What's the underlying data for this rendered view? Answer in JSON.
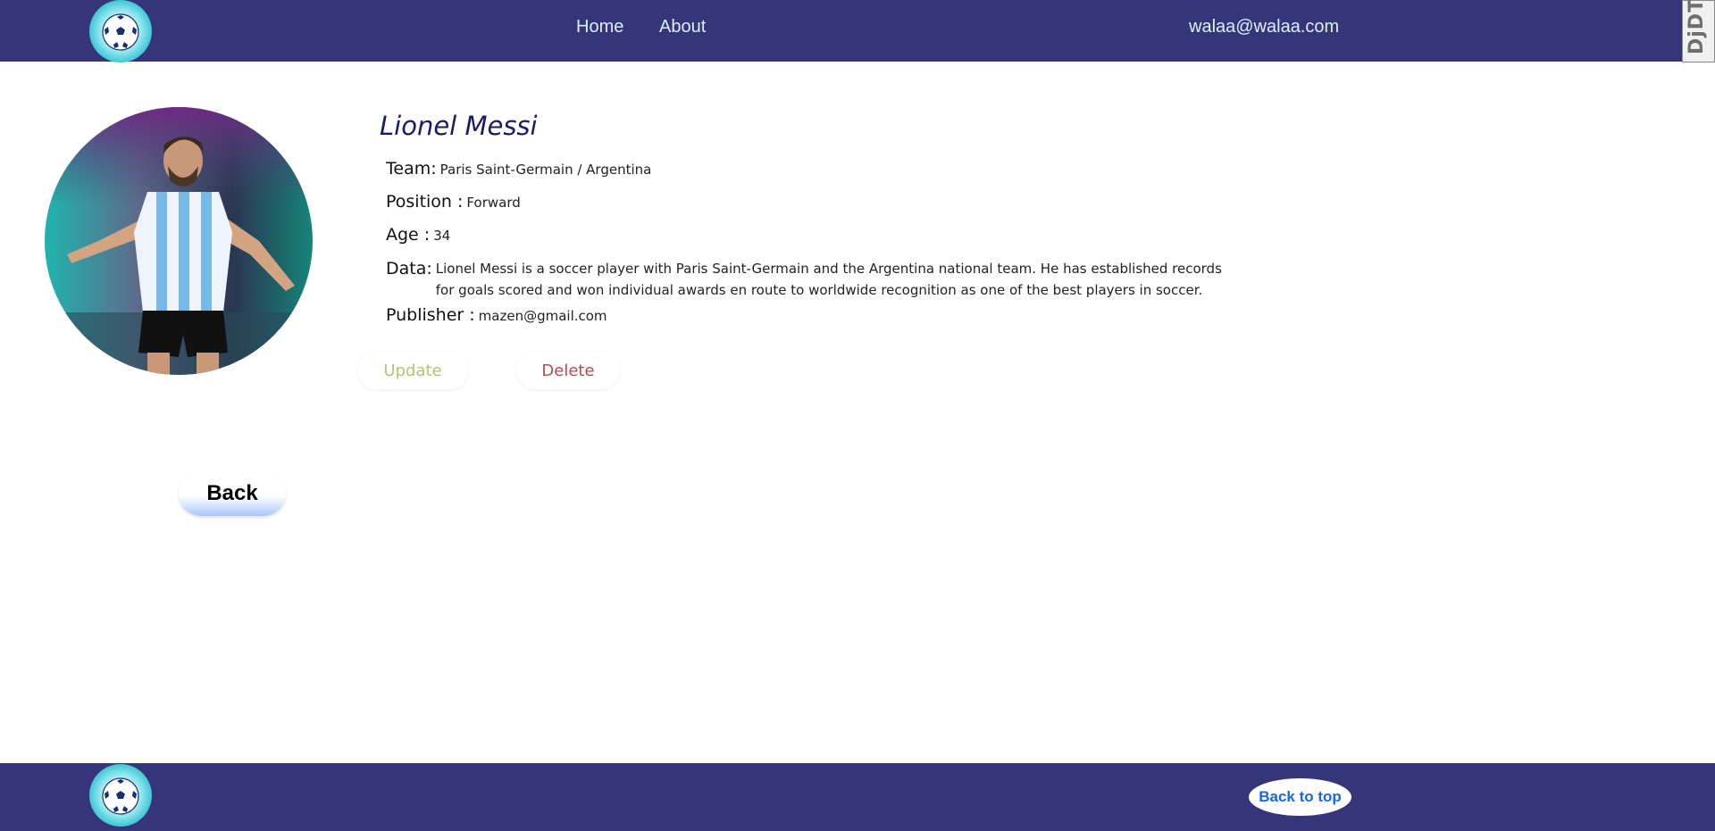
{
  "navbar": {
    "links": {
      "home": "Home",
      "about": "About"
    },
    "user_email": "walaa@walaa.com",
    "debug_toolbar": "DjDT",
    "logo_icon": "soccer-ball-icon"
  },
  "player": {
    "name": "Lionel Messi",
    "fields": {
      "team_label": "Team:",
      "team_value": "Paris Saint-Germain / Argentina",
      "position_label": "Position :",
      "position_value": "Forward",
      "age_label": "Age :",
      "age_value": "34",
      "data_label": "Data:",
      "data_value": "Lionel Messi is a soccer player with Paris Saint-Germain and the Argentina national team. He has established records for goals scored and won individual awards en route to worldwide recognition as one of the best players in soccer.",
      "publisher_label": "Publisher :",
      "publisher_value": "mazen@gmail.com"
    },
    "actions": {
      "update": "Update",
      "delete": "Delete"
    }
  },
  "back_button": "Back",
  "footer": {
    "back_to_top": "Back to top",
    "logo_icon": "soccer-ball-icon"
  },
  "colors": {
    "navbar_bg": "#36357a",
    "nav_text": "#d8f2ff",
    "name_color": "#1b1a66",
    "update_color": "#b3c36f",
    "delete_color": "#b44c4f",
    "back_to_top_color": "#1a66e0"
  }
}
